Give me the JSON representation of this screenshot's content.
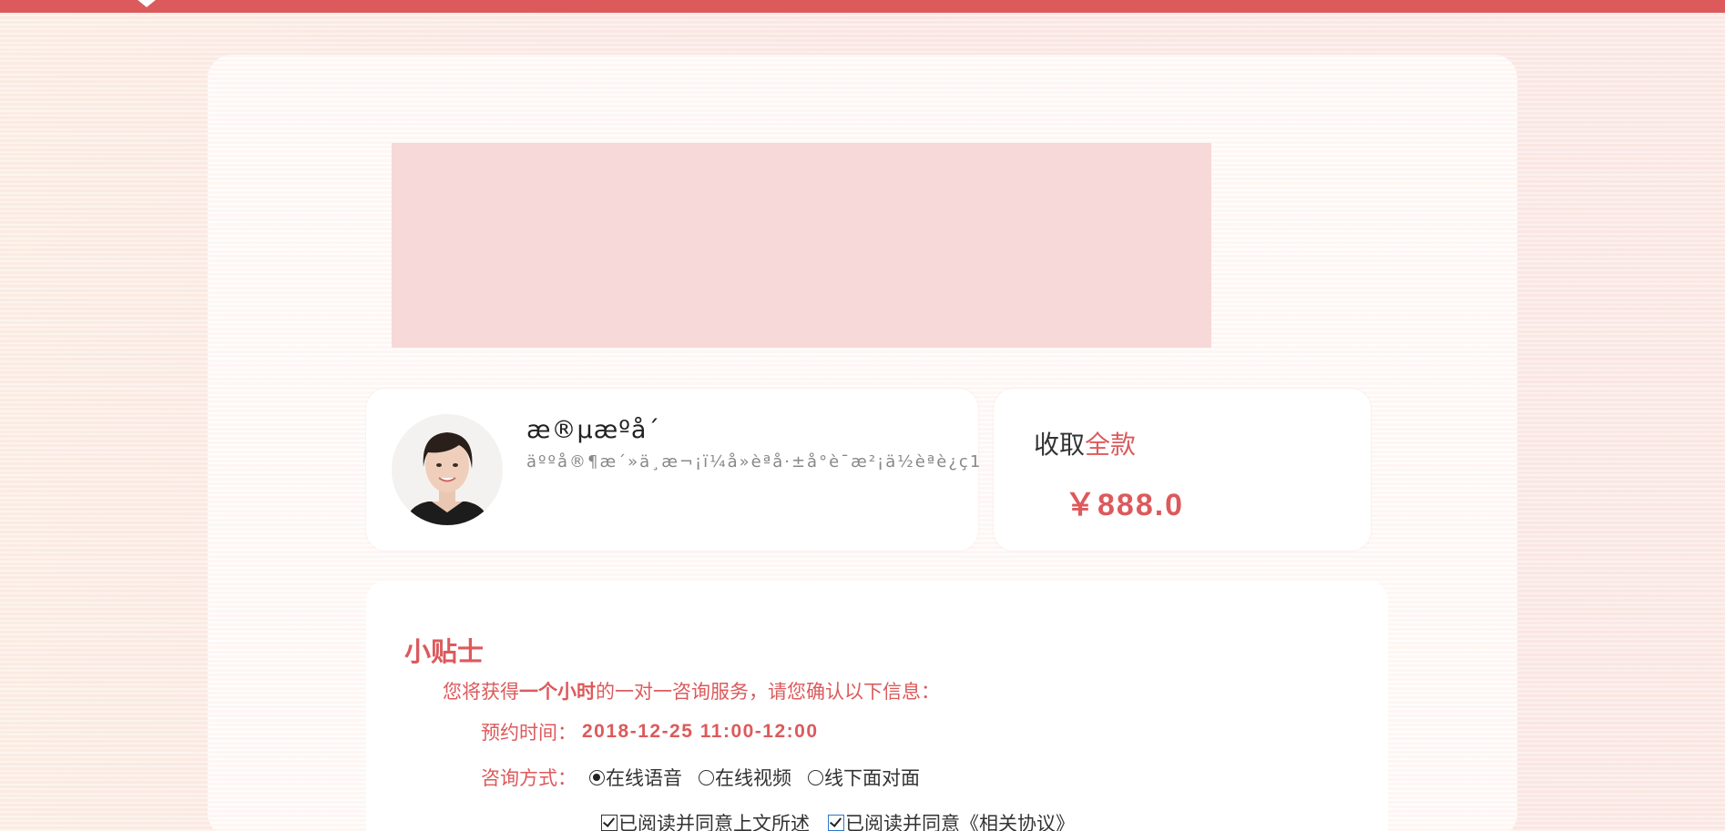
{
  "consultant": {
    "name": "æ®µæºå´",
    "description": "äººå®¶æ´»ä¸æ¬¡ï¼å»èªå·±å°è¯æ²¡ä½èªè¿ç1",
    "avatar_alt": "consultant portrait"
  },
  "price": {
    "label_prefix": "收取",
    "label_highlight": "全款",
    "value": "￥888.0"
  },
  "tips": {
    "title": "小贴士",
    "intro_before": "您将获得",
    "intro_bold": "一个小时",
    "intro_after": "的一对一咨询服务，请您确认以下信息：",
    "time_label": "预约时间：",
    "time_value": "2018-12-25 11:00-12:00",
    "mode_label": "咨询方式：",
    "mode_options": [
      "在线语音",
      "在线视频",
      "线下面对面"
    ],
    "mode_selected": "在线语音",
    "agreements": [
      "已阅读并同意上文所述",
      "已阅读并同意《相关协议》"
    ]
  },
  "colors": {
    "accent": "#dc5a5c",
    "banner": "#f6d9d8"
  }
}
